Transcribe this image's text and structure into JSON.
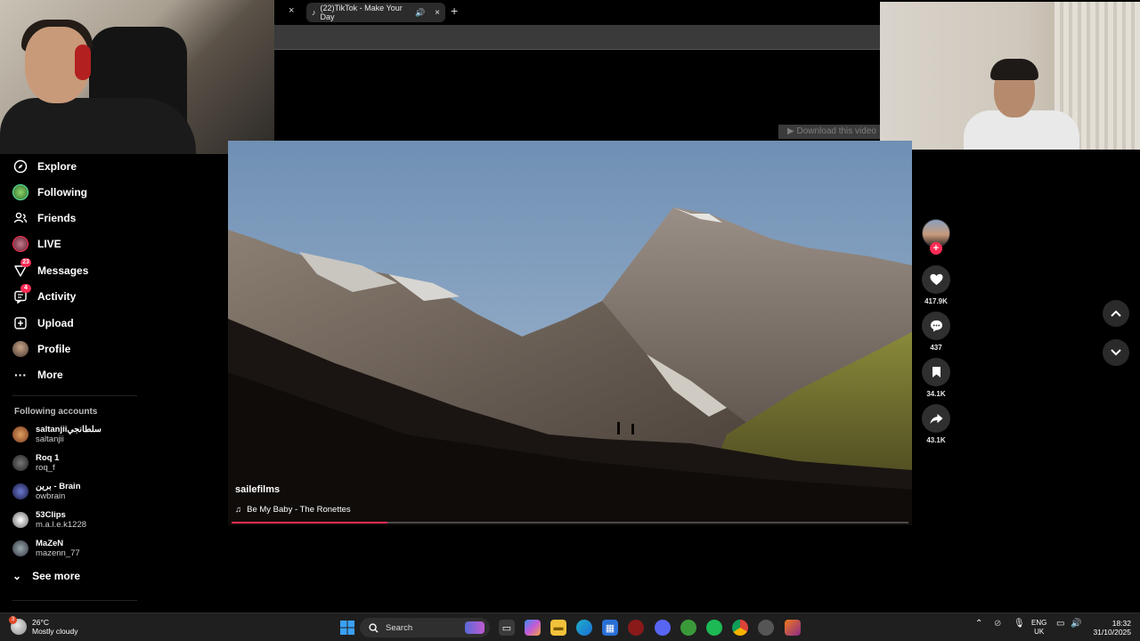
{
  "browser": {
    "tab_title": "(22)TikTok - Make Your Day",
    "close_glyph": "×",
    "new_tab_glyph": "+",
    "download_banner": "▶ Download this video"
  },
  "sidebar": {
    "nav": [
      {
        "label": "Explore",
        "icon": "explore-icon"
      },
      {
        "label": "Following",
        "icon": "following-avatar"
      },
      {
        "label": "Friends",
        "icon": "friends-icon"
      },
      {
        "label": "LIVE",
        "icon": "live-avatar"
      },
      {
        "label": "Messages",
        "icon": "messages-icon",
        "badge": "23"
      },
      {
        "label": "Activity",
        "icon": "activity-icon",
        "badge": "4"
      },
      {
        "label": "Upload",
        "icon": "upload-icon"
      },
      {
        "label": "Profile",
        "icon": "profile-avatar"
      },
      {
        "label": "More",
        "icon": "more-icon"
      }
    ],
    "following_title": "Following accounts",
    "accounts": [
      {
        "display": "saltanjiiسلطانجي",
        "user": "saltanjii"
      },
      {
        "display": "Roq 1",
        "user": "roq_f"
      },
      {
        "display": "برين - Brain",
        "user": "owbrain"
      },
      {
        "display": "53Clips",
        "user": "m.a.l.e.k1228"
      },
      {
        "display": "MaZeN",
        "user": "mazenn_77"
      }
    ],
    "see_more": "See more"
  },
  "video": {
    "author": "sailefilms",
    "music": "Be My Baby - The Ronettes",
    "music_icon": "♫",
    "progress": 0.23
  },
  "actions": {
    "follow_plus": "+",
    "likes": "417.9K",
    "comments": "437",
    "saves": "34.1K",
    "shares": "43.1K"
  },
  "taskbar": {
    "weather_temp": "26°C",
    "weather_desc": "Mostly cloudy",
    "weather_badge": "3",
    "search_label": "Search",
    "lang_top": "ENG",
    "lang_bottom": "UK",
    "time": "18:32",
    "date": "31/10/2025"
  },
  "colors": {
    "accent": "#fe2c55",
    "background": "#000000",
    "taskbar": "#1f1f1f"
  }
}
